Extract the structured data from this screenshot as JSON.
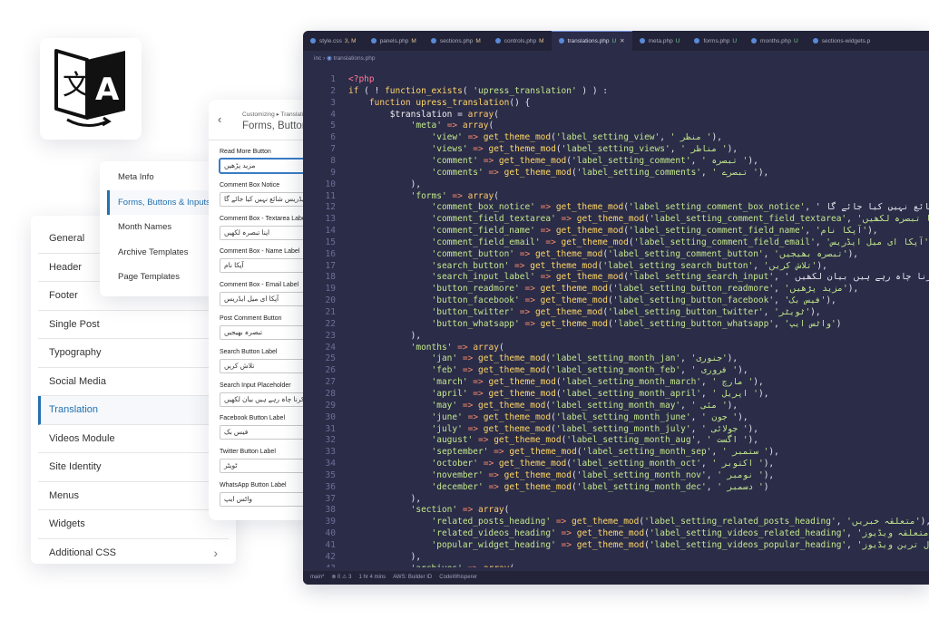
{
  "left_menu": {
    "items": [
      {
        "label": "General",
        "active": false
      },
      {
        "label": "Header",
        "active": false
      },
      {
        "label": "Footer",
        "active": false
      },
      {
        "label": "Single Post",
        "active": false
      },
      {
        "label": "Typography",
        "active": false
      },
      {
        "label": "Social Media",
        "active": false
      },
      {
        "label": "Translation",
        "active": true
      },
      {
        "label": "Videos Module",
        "active": false
      },
      {
        "label": "Site Identity",
        "active": false
      },
      {
        "label": "Menus",
        "active": false
      },
      {
        "label": "Widgets",
        "active": false
      },
      {
        "label": "Additional CSS",
        "active": false,
        "chevron": "›"
      }
    ]
  },
  "translation_menu": {
    "items": [
      {
        "label": "Meta Info",
        "active": false
      },
      {
        "label": "Forms, Buttons & Inputs",
        "active": true
      },
      {
        "label": "Month Names",
        "active": false
      },
      {
        "label": "Archive Templates",
        "active": false
      },
      {
        "label": "Page Templates",
        "active": false
      }
    ]
  },
  "form_panel": {
    "back": "‹",
    "breadcrumb": "Customizing ▸ Translation",
    "title": "Forms, Buttons & Inputs",
    "fields": [
      {
        "label": "Read More Button",
        "value": "مزید پڑھیں",
        "focused": true
      },
      {
        "label": "Comment Box Notice",
        "value": "آپکا ای میل ایڈریس شائع نہیں کیا جائے گا",
        "focused": false
      },
      {
        "label": "Comment Box - Textarea Label",
        "value": "اپنا تبصرہ لکھیں",
        "focused": false
      },
      {
        "label": "Comment Box - Name Label",
        "value": "آپکا نام",
        "focused": false
      },
      {
        "label": "Comment Box - Email Label",
        "value": "آپکا ای میل ایڈریس",
        "focused": false
      },
      {
        "label": "Post Comment Button",
        "value": "تبصرہ بھیجیں",
        "focused": false
      },
      {
        "label": "Search Button Label",
        "value": "تلاش کریں",
        "focused": false
      },
      {
        "label": "Search Input Placeholder",
        "value": "جو تلاش کرنا چاہ رہے ہیں بیان لکھیں",
        "focused": false
      },
      {
        "label": "Facebook Button Label",
        "value": "فیس بک",
        "focused": false
      },
      {
        "label": "Twitter Button Label",
        "value": "ٹویٹر",
        "focused": false
      },
      {
        "label": "WhatsApp Button Label",
        "value": "واٹس ایپ",
        "focused": false
      }
    ]
  },
  "editor": {
    "tabs": [
      {
        "label": "style.css",
        "status": "3, M",
        "active": false
      },
      {
        "label": "panels.php",
        "status": "M",
        "active": false
      },
      {
        "label": "sections.php",
        "status": "M",
        "active": false
      },
      {
        "label": "controls.php",
        "status": "M",
        "active": false
      },
      {
        "label": "translations.php",
        "status": "U",
        "active": true
      },
      {
        "label": "meta.php",
        "status": "U",
        "active": false
      },
      {
        "label": "forms.php",
        "status": "U",
        "active": false
      },
      {
        "label": "months.php",
        "status": "U",
        "active": false
      },
      {
        "label": "sections-widgets.p",
        "status": "",
        "active": false
      }
    ],
    "breadcrumb_dir": "inc",
    "breadcrumb_file": "translations.php",
    "status_items": [
      "main*",
      "⊗ 0 ⚠ 3",
      "1 hr 4 mins",
      "AWS: Builder ID",
      "CodeWhisperer"
    ],
    "lines": [
      {
        "n": "1",
        "t": "<?php"
      },
      {
        "n": "2",
        "t": "if ( ! function_exists( 'upress_translation' ) ) :"
      },
      {
        "n": "3",
        "t": "    function upress_translation() {"
      },
      {
        "n": "4",
        "t": "        $translation = array("
      },
      {
        "n": "5",
        "t": "            'meta' => array("
      },
      {
        "n": "6",
        "t": "                'view' => get_theme_mod('label_setting_view', ' منظر '),"
      },
      {
        "n": "7",
        "t": "                'views' => get_theme_mod('label_setting_views', ' مناظر '),"
      },
      {
        "n": "8",
        "t": "                'comment' => get_theme_mod('label_setting_comment', ' تبصرہ '),"
      },
      {
        "n": "9",
        "t": "                'comments' => get_theme_mod('label_setting_comments', ' تبصرے '),"
      },
      {
        "n": "10",
        "t": "            ),"
      },
      {
        "n": "11",
        "t": "            'forms' => array("
      },
      {
        "n": "12",
        "t": "                'comment_box_notice' => get_theme_mod('label_setting_comment_box_notice', ' ایڈریس شائع نہیں کیا جائے گا"
      },
      {
        "n": "13",
        "t": "                'comment_field_textarea' => get_theme_mod('label_setting_comment_field_textarea', 'اپنا تبصرہ لکھیں'),"
      },
      {
        "n": "14",
        "t": "                'comment_field_name' => get_theme_mod('label_setting_comment_field_name', 'آپکا نام'),"
      },
      {
        "n": "15",
        "t": "                'comment_field_email' => get_theme_mod('label_setting_comment_field_email', 'آپکا ای میل ایڈریس'),"
      },
      {
        "n": "16",
        "t": "                'comment_button' => get_theme_mod('label_setting_comment_button', 'تبصرہ بھیجیں'),"
      },
      {
        "n": "17",
        "t": "                'search_button' => get_theme_mod('label_setting_search_button', 'تلاش کریں'),"
      },
      {
        "n": "18",
        "t": "                'search_input_label' => get_theme_mod('label_setting_search_input', ' جو تلاش کرنا چاہ رہے ہیں بیان لکھیں"
      },
      {
        "n": "19",
        "t": "                'button_readmore' => get_theme_mod('label_setting_button_readmore', 'مزید پڑھیں'),"
      },
      {
        "n": "20",
        "t": "                'button_facebook' => get_theme_mod('label_setting_button_facebook', 'فیس بک'),"
      },
      {
        "n": "21",
        "t": "                'button_twitter' => get_theme_mod('label_setting_button_twitter', 'ٹویٹر'),"
      },
      {
        "n": "22",
        "t": "                'button_whatsapp' => get_theme_mod('label_setting_button_whatsapp', 'واٹس ایپ')"
      },
      {
        "n": "23",
        "t": "            ),"
      },
      {
        "n": "24",
        "t": "            'months' => array("
      },
      {
        "n": "25",
        "t": "                'jan' => get_theme_mod('label_setting_month_jan', 'جنوری'),"
      },
      {
        "n": "26",
        "t": "                'feb' => get_theme_mod('label_setting_month_feb', ' فروری '),"
      },
      {
        "n": "27",
        "t": "                'march' => get_theme_mod('label_setting_month_march', ' مارچ '),"
      },
      {
        "n": "28",
        "t": "                'april' => get_theme_mod('label_setting_month_april', ' اپریل '),"
      },
      {
        "n": "29",
        "t": "                'may' => get_theme_mod('label_setting_month_may', ' مئی '),"
      },
      {
        "n": "30",
        "t": "                'june' => get_theme_mod('label_setting_month_june', ' جون '),"
      },
      {
        "n": "31",
        "t": "                'july' => get_theme_mod('label_setting_month_july', ' جولائی '),"
      },
      {
        "n": "32",
        "t": "                'august' => get_theme_mod('label_setting_month_aug', ' اگست '),"
      },
      {
        "n": "33",
        "t": "                'september' => get_theme_mod('label_setting_month_sep', ' ستمبر '),"
      },
      {
        "n": "34",
        "t": "                'october' => get_theme_mod('label_setting_month_oct', ' اکتوبر '),"
      },
      {
        "n": "35",
        "t": "                'november' => get_theme_mod('label_setting_month_nov', ' نومبر '),"
      },
      {
        "n": "36",
        "t": "                'december' => get_theme_mod('label_setting_month_dec', ' دسمبر ')"
      },
      {
        "n": "37",
        "t": "            ),"
      },
      {
        "n": "38",
        "t": "            'section' => array("
      },
      {
        "n": "39",
        "t": "                'related_posts_heading' => get_theme_mod('label_setting_related_posts_heading', 'متعلقہ خبریں'),"
      },
      {
        "n": "40",
        "t": "                'related_videos_heading' => get_theme_mod('label_setting_videos_related_heading', 'متعلقہ ویڈیوز'),"
      },
      {
        "n": "41",
        "t": "                'popular_widget_heading' => get_theme_mod('label_setting_videos_popular_heading', 'مقبول ترین ویڈیوز'),"
      },
      {
        "n": "42",
        "t": "            ),"
      },
      {
        "n": "43",
        "t": "            'archives' => array("
      }
    ]
  },
  "colors": {
    "accent": "#2271b1",
    "editor_bg": "#2b2c48",
    "keyword": "#ffcb6b",
    "string": "#c3e88d"
  },
  "icons": {
    "translate": "translate-icon",
    "chevron": "chevron-right-icon",
    "back": "back-icon",
    "file": "php-file-icon"
  }
}
